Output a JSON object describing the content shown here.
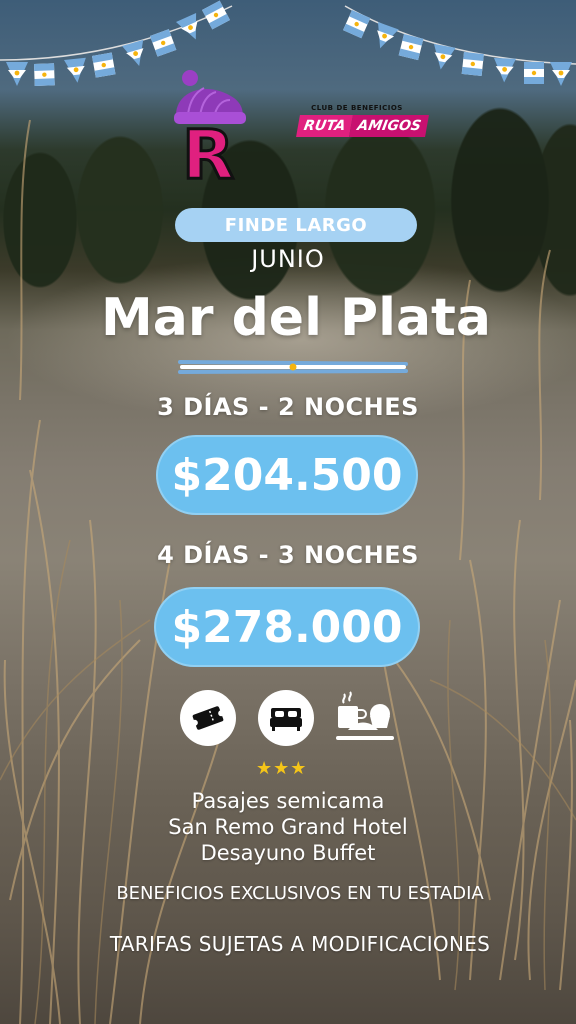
{
  "brand": {
    "letter": "R",
    "club_top": "CLUB DE BENEFICIOS",
    "club_name_1": "RUTA",
    "club_name_2": "AMIGOS",
    "accent_color": "#e0207f"
  },
  "promo": {
    "tag": "FINDE LARGO",
    "month": "JUNIO",
    "destination": "Mar del Plata"
  },
  "packages": [
    {
      "duration": "3 DÍAS - 2 NOCHES",
      "price": "$204.500"
    },
    {
      "duration": "4 DÍAS - 3 NOCHES",
      "price": "$278.000"
    }
  ],
  "amenities": {
    "icons": [
      "ticket-icon",
      "bed-icon",
      "breakfast-icon"
    ],
    "stars": "★★★",
    "lines": [
      "Pasajes semicama",
      "San Remo Grand Hotel",
      "Desayuno Buffet"
    ]
  },
  "notes": {
    "benefits": "BENEFICIOS EXCLUSIVOS EN TU ESTADIA",
    "disclaimer": "TARIFAS SUJETAS A MODIFICACIONES"
  },
  "colors": {
    "pill_light": "#a6d2f3",
    "pill_price": "#6cc0ef",
    "flag_blue": "#75aadb",
    "sun": "#f6b40e"
  }
}
